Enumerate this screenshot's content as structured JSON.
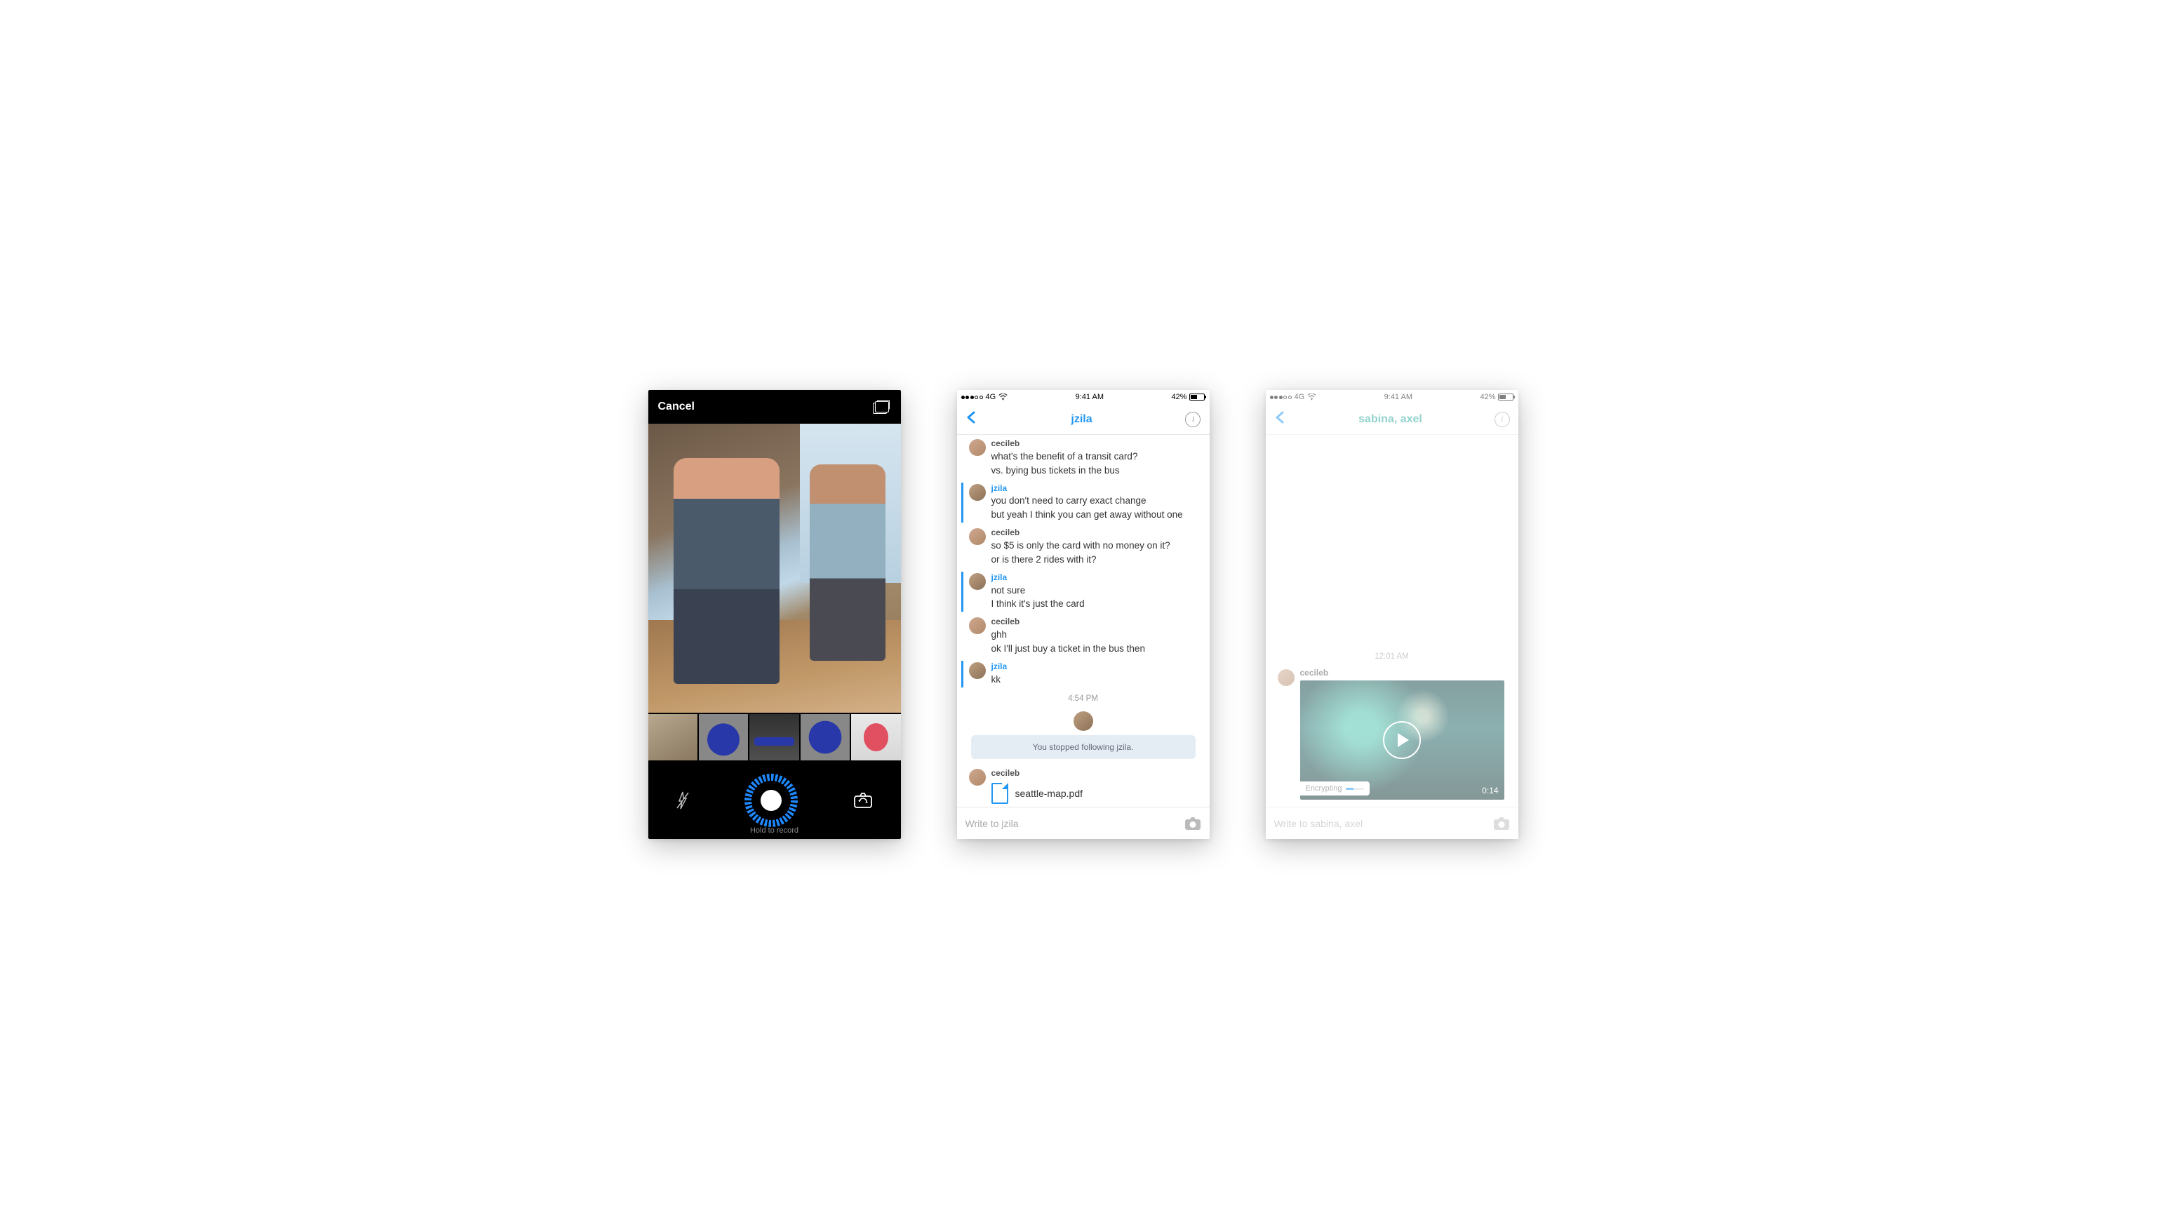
{
  "statusBar": {
    "carrier": "4G",
    "time": "9:41 AM",
    "batteryPct": "42%"
  },
  "screen1": {
    "cancel": "Cancel",
    "holdToRecord": "Hold to record"
  },
  "screen2": {
    "title": "jzila",
    "messages": [
      {
        "author": "cecileb",
        "authorClass": "cecileb",
        "bar": false,
        "avatar": "a1",
        "lines": [
          "what's the benefit of a transit card?",
          "vs. bying bus tickets in the bus"
        ]
      },
      {
        "author": "jzila",
        "authorClass": "jzila",
        "bar": true,
        "avatar": "a2",
        "lines": [
          "you don't need to carry exact change",
          "but yeah I think you can get away without one"
        ]
      },
      {
        "author": "cecileb",
        "authorClass": "cecileb",
        "bar": false,
        "avatar": "a1",
        "lines": [
          "so $5 is only the card with no money on it?",
          "or is there 2 rides with it?"
        ]
      },
      {
        "author": "jzila",
        "authorClass": "jzila",
        "bar": true,
        "avatar": "a2",
        "lines": [
          "not sure",
          "I think it's just the card"
        ]
      },
      {
        "author": "cecileb",
        "authorClass": "cecileb",
        "bar": false,
        "avatar": "a1",
        "lines": [
          "ghh",
          "ok I'll just buy a ticket in the bus then"
        ]
      },
      {
        "author": "jzila",
        "authorClass": "jzila",
        "bar": true,
        "avatar": "a2",
        "lines": [
          "kk"
        ]
      }
    ],
    "divider": "4:54 PM",
    "systemMsg": "You stopped following jzila.",
    "attachmentAuthor": "cecileb",
    "attachmentName": "seattle-map.pdf",
    "composePlaceholder": "Write to jzila"
  },
  "screen3": {
    "title": "sabina, axel",
    "timestamp": "12:01 AM",
    "videoAuthor": "cecileb",
    "encryptingLabel": "Encrypting",
    "videoDuration": "0:14",
    "composePlaceholder": "Write to sabina, axel"
  }
}
